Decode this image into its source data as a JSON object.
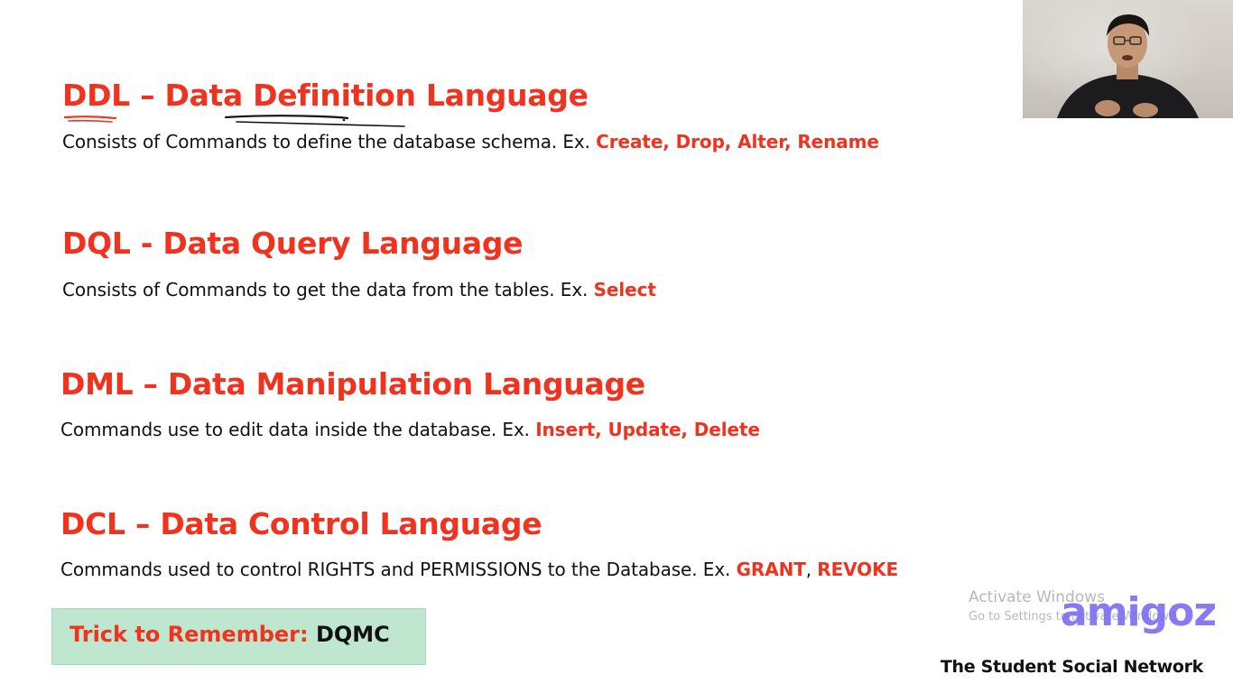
{
  "sections": [
    {
      "heading": "DDL – Data Definition Language",
      "description": "Consists of Commands to define the database schema. Ex. ",
      "examples": "Create, Drop, Alter, Rename"
    },
    {
      "heading": "DQL - Data Query Language",
      "description": "Consists of Commands to get the data from the tables. Ex. ",
      "examples": "Select"
    },
    {
      "heading": "DML – Data Manipulation Language",
      "description": "Commands use to edit data inside the database. Ex. ",
      "examples": "Insert, Update, Delete"
    },
    {
      "heading": "DCL – Data Control Language",
      "description": "Commands used to control RIGHTS and PERMISSIONS to the Database. Ex. ",
      "examples_part1": "GRANT",
      "examples_separator": ", ",
      "examples_part2": "REVOKE"
    }
  ],
  "trick": {
    "label": "Trick to Remember: ",
    "value": "DQMC"
  },
  "watermark": {
    "line1": "Activate Windows",
    "line2": "Go to Settings to activate Windows."
  },
  "brand": {
    "logo_text": "amigoz",
    "tagline": "The Student Social Network"
  },
  "colors": {
    "accent_red": "#f0321e",
    "brand_purple": "#7e6ff2",
    "trick_box_bg": "#bfe6cf"
  },
  "icons": {
    "webcam": "presenter-video-feed"
  }
}
